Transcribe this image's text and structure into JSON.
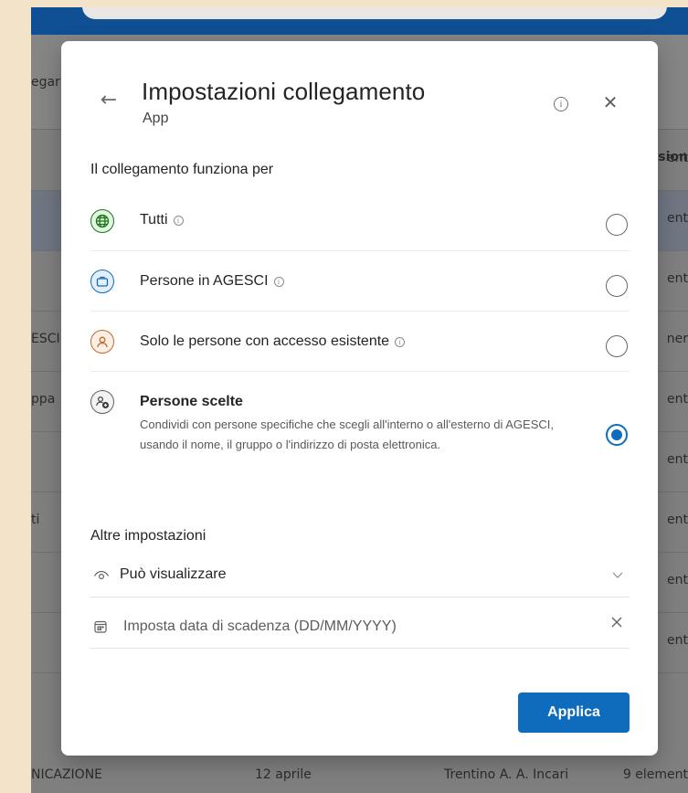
{
  "background": {
    "side_text_top": "egar",
    "col_header": "sion",
    "rows": [
      {
        "left": "",
        "right": "ent"
      },
      {
        "left": "",
        "right": "ent"
      },
      {
        "left": "",
        "right": "ent"
      },
      {
        "left": "ESCI",
        "right": "ner"
      },
      {
        "left": "ppa",
        "right": "ent"
      },
      {
        "left": "",
        "right": "ent"
      },
      {
        "left": "ti",
        "right": "ent"
      },
      {
        "left": "",
        "right": "ent"
      },
      {
        "left": "",
        "right": "ent"
      },
      {
        "left": "NICAZIONE",
        "mid1": "12 aprile",
        "mid2": "Trentino A. A. Incari",
        "right": "9 element"
      }
    ]
  },
  "modal": {
    "title": "Impostazioni collegamento",
    "subtitle": "App",
    "info_symbol": "i",
    "close_symbol": "✕",
    "back_symbol": "←"
  },
  "section_works_for": "Il collegamento funziona per",
  "options": [
    {
      "label": "Tutti",
      "checked": false
    },
    {
      "label": "Persone in AGESCI",
      "checked": false
    },
    {
      "label": "Solo le persone con accesso esistente",
      "checked": false
    },
    {
      "label": "Persone scelte",
      "description": "Condividi con persone specifiche che scegli all'interno o all'esterno di AGESCI, usando il nome, il gruppo o l'indirizzo di posta elettronica.",
      "checked": true
    }
  ],
  "section_other": "Altre impostazioni",
  "permission": {
    "label": "Può visualizzare"
  },
  "expiry": {
    "placeholder": "Imposta data di scadenza (DD/MM/YYYY)"
  },
  "apply_label": "Applica",
  "colors": {
    "accent": "#0f6cbd",
    "globe": "#107c10",
    "briefcase": "#0f6cbd",
    "person": "#c36a2e"
  }
}
